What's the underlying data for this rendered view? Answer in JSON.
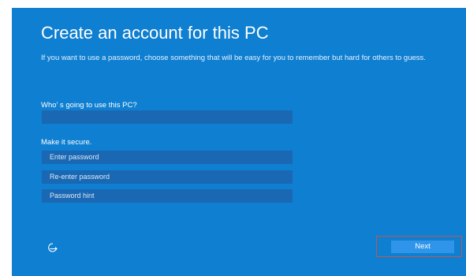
{
  "header": {
    "title": "Create an account for this PC",
    "description": "If you want to use a password, choose something that will be easy for you to remember but hard for others to guess."
  },
  "username": {
    "label": "Who’ s going to use this PC?",
    "value": ""
  },
  "security": {
    "label": "Make it secure.",
    "password_placeholder": "Enter password",
    "reenter_placeholder": "Re-enter password",
    "hint_placeholder": "Password hint"
  },
  "footer": {
    "accessibility_icon": "ease-of-access-icon",
    "next_label": "Next"
  },
  "colors": {
    "background": "#0f7fd1",
    "field": "#1a68b3",
    "next_button": "#2f95ea",
    "highlight_outline": "#c0574f"
  }
}
